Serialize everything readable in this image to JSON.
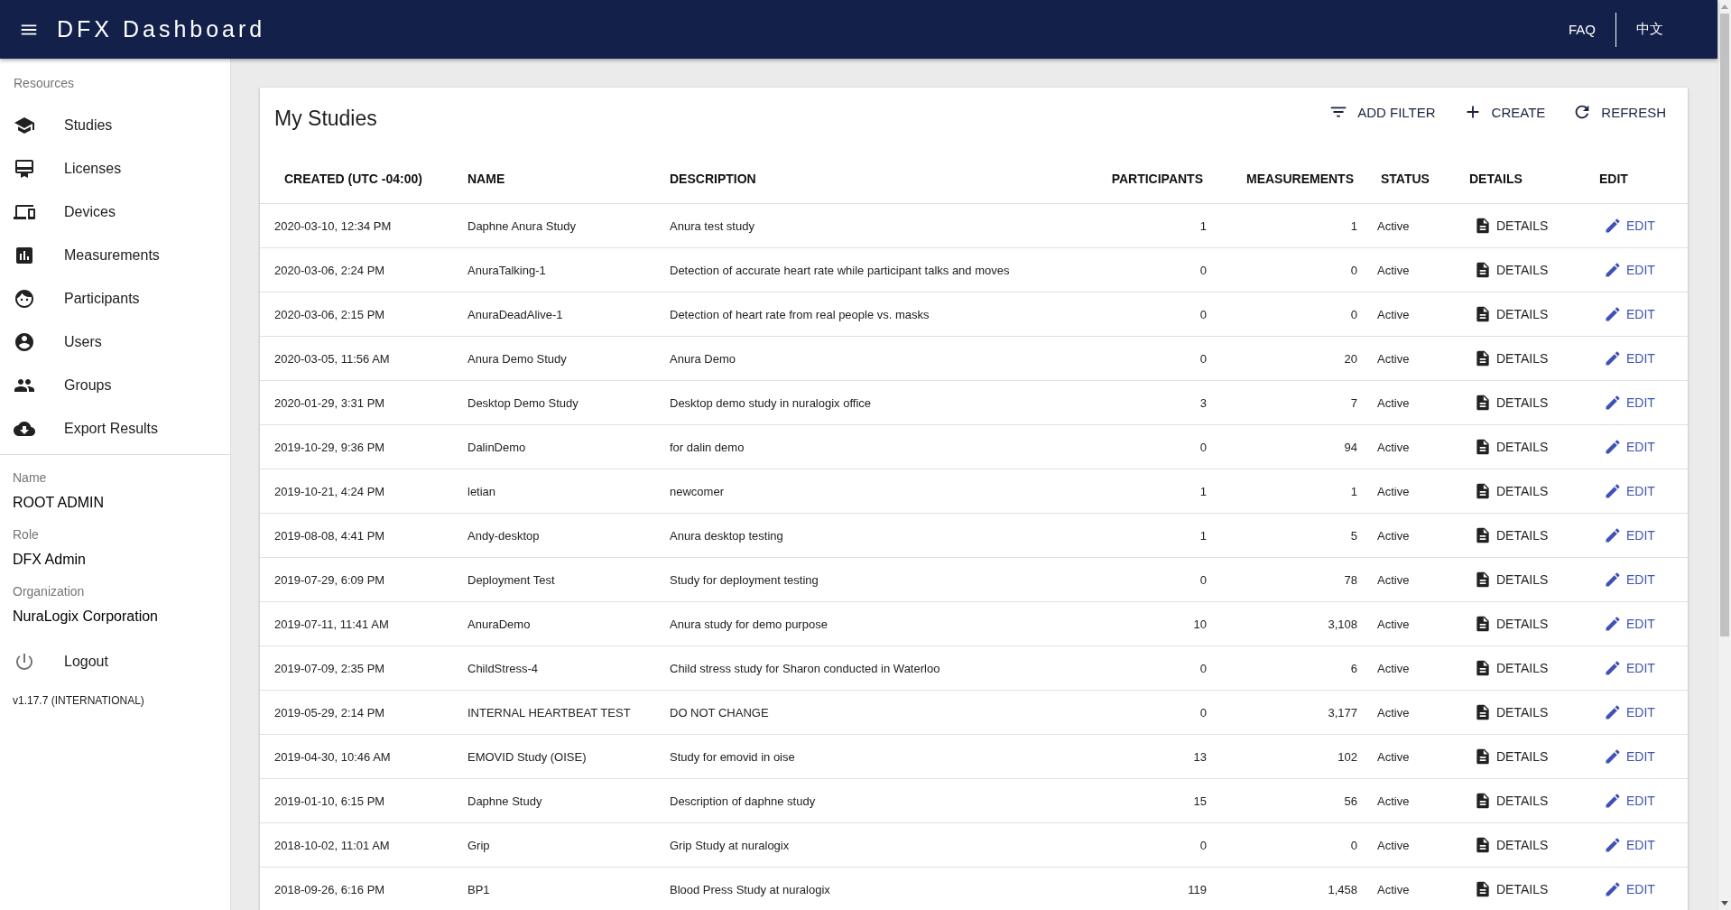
{
  "header": {
    "title": "DFX Dashboard",
    "links": [
      "FAQ",
      "中文"
    ]
  },
  "sidebar": {
    "section_label": "Resources",
    "items": [
      {
        "label": "Studies"
      },
      {
        "label": "Licenses"
      },
      {
        "label": "Devices"
      },
      {
        "label": "Measurements"
      },
      {
        "label": "Participants"
      },
      {
        "label": "Users"
      },
      {
        "label": "Groups"
      },
      {
        "label": "Export Results"
      }
    ],
    "user_info": [
      {
        "label": "Name",
        "value": "ROOT ADMIN"
      },
      {
        "label": "Role",
        "value": "DFX Admin"
      },
      {
        "label": "Organization",
        "value": "NuraLogix Corporation"
      }
    ],
    "logout": "Logout",
    "version": "v1.17.7 (INTERNATIONAL)"
  },
  "card": {
    "title": "My Studies",
    "actions": [
      "ADD FILTER",
      "CREATE",
      "REFRESH"
    ]
  },
  "table": {
    "columns": [
      "CREATED (UTC -04:00)",
      "NAME",
      "DESCRIPTION",
      "PARTICIPANTS",
      "MEASUREMENTS",
      "STATUS",
      "DETAILS",
      "EDIT"
    ],
    "rows": [
      {
        "created": "2020-03-10, 12:34 PM",
        "name": "Daphne Anura Study",
        "description": "Anura test study",
        "participants": "1",
        "measurements": "1",
        "status": "Active",
        "details": "DETAILS",
        "edit": "EDIT"
      },
      {
        "created": "2020-03-06, 2:24 PM",
        "name": "AnuraTalking-1",
        "description": "Detection of accurate heart rate while participant talks and moves",
        "participants": "0",
        "measurements": "0",
        "status": "Active",
        "details": "DETAILS",
        "edit": "EDIT"
      },
      {
        "created": "2020-03-06, 2:15 PM",
        "name": "AnuraDeadAlive-1",
        "description": "Detection of heart rate from real people vs. masks",
        "participants": "0",
        "measurements": "0",
        "status": "Active",
        "details": "DETAILS",
        "edit": "EDIT"
      },
      {
        "created": "2020-03-05, 11:56 AM",
        "name": "Anura Demo Study",
        "description": "Anura Demo",
        "participants": "0",
        "measurements": "20",
        "status": "Active",
        "details": "DETAILS",
        "edit": "EDIT"
      },
      {
        "created": "2020-01-29, 3:31 PM",
        "name": "Desktop Demo Study",
        "description": "Desktop demo study in nuralogix office",
        "participants": "3",
        "measurements": "7",
        "status": "Active",
        "details": "DETAILS",
        "edit": "EDIT"
      },
      {
        "created": "2019-10-29, 9:36 PM",
        "name": "DalinDemo",
        "description": "for dalin demo",
        "participants": "0",
        "measurements": "94",
        "status": "Active",
        "details": "DETAILS",
        "edit": "EDIT"
      },
      {
        "created": "2019-10-21, 4:24 PM",
        "name": "letian",
        "description": "newcomer",
        "participants": "1",
        "measurements": "1",
        "status": "Active",
        "details": "DETAILS",
        "edit": "EDIT"
      },
      {
        "created": "2019-08-08, 4:41 PM",
        "name": "Andy-desktop",
        "description": "Anura desktop testing",
        "participants": "1",
        "measurements": "5",
        "status": "Active",
        "details": "DETAILS",
        "edit": "EDIT"
      },
      {
        "created": "2019-07-29, 6:09 PM",
        "name": "Deployment Test",
        "description": "Study for deployment testing",
        "participants": "0",
        "measurements": "78",
        "status": "Active",
        "details": "DETAILS",
        "edit": "EDIT"
      },
      {
        "created": "2019-07-11, 11:41 AM",
        "name": "AnuraDemo",
        "description": "Anura study for demo purpose",
        "participants": "10",
        "measurements": "3,108",
        "status": "Active",
        "details": "DETAILS",
        "edit": "EDIT"
      },
      {
        "created": "2019-07-09, 2:35 PM",
        "name": "ChildStress-4",
        "description": "Child stress study for Sharon conducted in Waterloo",
        "participants": "0",
        "measurements": "6",
        "status": "Active",
        "details": "DETAILS",
        "edit": "EDIT"
      },
      {
        "created": "2019-05-29, 2:14 PM",
        "name": "INTERNAL HEARTBEAT TEST",
        "description": "DO NOT CHANGE",
        "participants": "0",
        "measurements": "3,177",
        "status": "Active",
        "details": "DETAILS",
        "edit": "EDIT"
      },
      {
        "created": "2019-04-30, 10:46 AM",
        "name": "EMOVID Study (OISE)",
        "description": "Study for emovid in oise",
        "participants": "13",
        "measurements": "102",
        "status": "Active",
        "details": "DETAILS",
        "edit": "EDIT"
      },
      {
        "created": "2019-01-10, 6:15 PM",
        "name": "Daphne Study",
        "description": "Description of daphne study",
        "participants": "15",
        "measurements": "56",
        "status": "Active",
        "details": "DETAILS",
        "edit": "EDIT"
      },
      {
        "created": "2018-10-02, 11:01 AM",
        "name": "Grip",
        "description": "Grip Study at nuralogix",
        "participants": "0",
        "measurements": "0",
        "status": "Active",
        "details": "DETAILS",
        "edit": "EDIT"
      },
      {
        "created": "2018-09-26, 6:16 PM",
        "name": "BP1",
        "description": "Blood Press Study at nuralogix",
        "participants": "119",
        "measurements": "1,458",
        "status": "Active",
        "details": "DETAILS",
        "edit": "EDIT"
      }
    ]
  }
}
